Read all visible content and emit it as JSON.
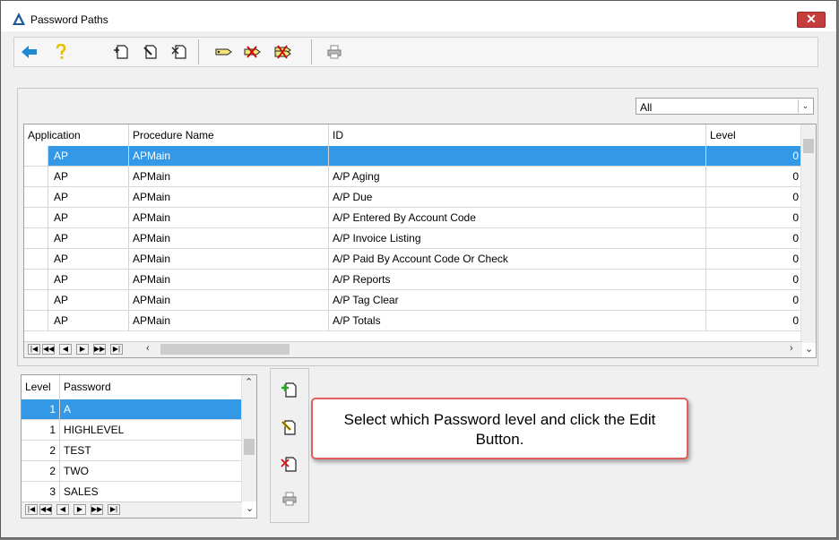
{
  "window": {
    "title": "Password Paths"
  },
  "filter": {
    "value": "All"
  },
  "grid1": {
    "columns": [
      "Application",
      "Procedure Name",
      "ID",
      "Level"
    ],
    "rows": [
      {
        "app": "AP",
        "proc": "APMain",
        "id": "",
        "level": "0"
      },
      {
        "app": "AP",
        "proc": "APMain",
        "id": "A/P Aging",
        "level": "0"
      },
      {
        "app": "AP",
        "proc": "APMain",
        "id": "A/P Due",
        "level": "0"
      },
      {
        "app": "AP",
        "proc": "APMain",
        "id": "A/P Entered By Account Code",
        "level": "0"
      },
      {
        "app": "AP",
        "proc": "APMain",
        "id": "A/P Invoice Listing",
        "level": "0"
      },
      {
        "app": "AP",
        "proc": "APMain",
        "id": "A/P Paid By Account Code Or Check",
        "level": "0"
      },
      {
        "app": "AP",
        "proc": "APMain",
        "id": "A/P Reports",
        "level": "0"
      },
      {
        "app": "AP",
        "proc": "APMain",
        "id": "A/P Tag Clear",
        "level": "0"
      },
      {
        "app": "AP",
        "proc": "APMain",
        "id": "A/P Totals",
        "level": "0"
      }
    ]
  },
  "grid2": {
    "columns": [
      "Level",
      "Password"
    ],
    "rows": [
      {
        "level": "1",
        "password": "A"
      },
      {
        "level": "1",
        "password": "HIGHLEVEL"
      },
      {
        "level": "2",
        "password": "TEST"
      },
      {
        "level": "2",
        "password": "TWO"
      },
      {
        "level": "3",
        "password": "SALES"
      }
    ]
  },
  "callout": {
    "text": "Select which Password level and click the Edit Button."
  },
  "icons": [
    "app-logo-icon",
    "close-icon",
    "back-arrow-icon",
    "help-icon",
    "add-record-icon",
    "edit-record-icon",
    "delete-record-icon",
    "tag-icon",
    "untag-icon",
    "clear-tags-icon",
    "printer-icon"
  ],
  "colors": {
    "selection": "#3399e6",
    "callout_border": "#e06060",
    "close": "#c43c3c"
  }
}
